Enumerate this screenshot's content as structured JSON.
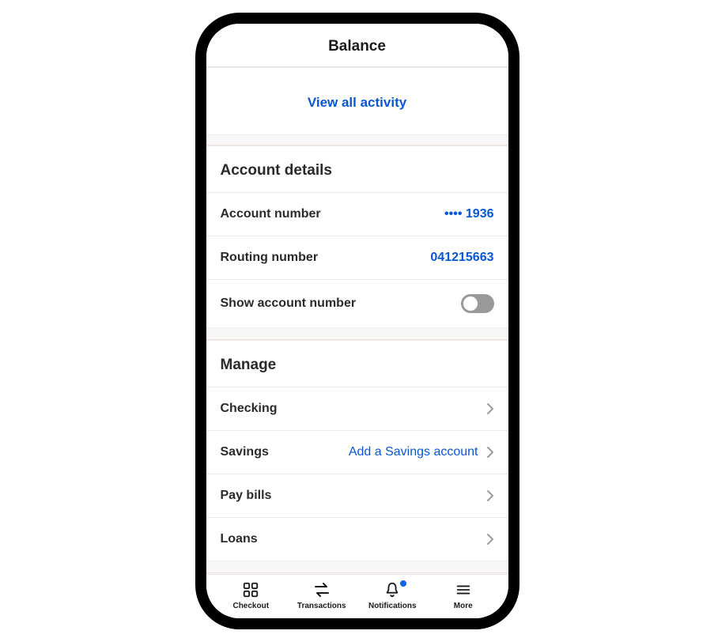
{
  "header": {
    "title": "Balance"
  },
  "activity": {
    "view_all": "View all activity"
  },
  "details": {
    "header": "Account details",
    "account_number": {
      "label": "Account number",
      "value": "•••• 1936"
    },
    "routing_number": {
      "label": "Routing number",
      "value": "041215663"
    },
    "show_toggle": {
      "label": "Show account number",
      "on": false
    }
  },
  "manage": {
    "header": "Manage",
    "checking": {
      "label": "Checking"
    },
    "savings": {
      "label": "Savings",
      "action": "Add a Savings account"
    },
    "pay_bills": {
      "label": "Pay bills"
    },
    "loans": {
      "label": "Loans"
    }
  },
  "tabs": {
    "checkout": {
      "label": "Checkout"
    },
    "transactions": {
      "label": "Transactions"
    },
    "notifications": {
      "label": "Notifications",
      "has_badge": true
    },
    "more": {
      "label": "More"
    }
  }
}
